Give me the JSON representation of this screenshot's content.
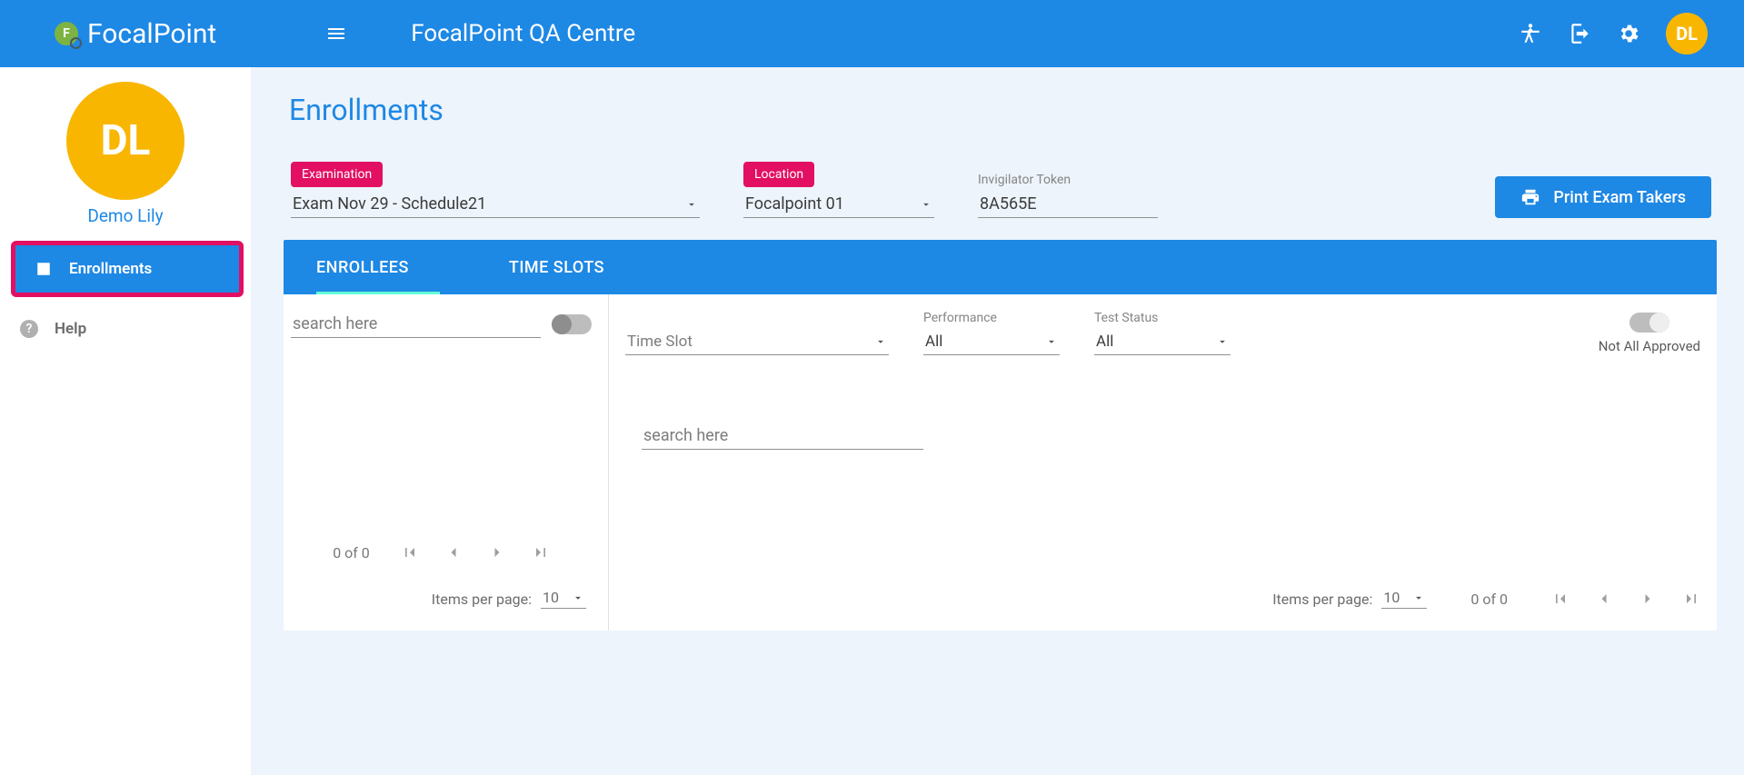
{
  "app": {
    "logo_letter": "F",
    "name": "FocalPoint",
    "centre": "FocalPoint QA Centre"
  },
  "user": {
    "initials": "DL",
    "name": "Demo Lily"
  },
  "nav": {
    "enrollments": "Enrollments",
    "help": "Help"
  },
  "page": {
    "title": "Enrollments"
  },
  "filters": {
    "exam_label": "Examination",
    "exam_value": "Exam Nov 29 - Schedule21",
    "loc_label": "Location",
    "loc_value": "Focalpoint 01",
    "token_label": "Invigilator Token",
    "token_value": "8A565E",
    "print_btn": "Print Exam Takers"
  },
  "tabs": {
    "enrollees": "ENROLLEES",
    "timeslots": "TIME SLOTS"
  },
  "left": {
    "search_ph": "search here",
    "pager": {
      "count": "0 of 0"
    },
    "ipp": {
      "label": "Items per page:",
      "value": "10"
    }
  },
  "right": {
    "timeslot_ph": "Time Slot",
    "perf": {
      "label": "Performance",
      "value": "All"
    },
    "status": {
      "label": "Test Status",
      "value": "All"
    },
    "approve": "Not All Approved",
    "search_ph": "search here",
    "ipp": {
      "label": "Items per page:",
      "value": "10"
    },
    "pager": {
      "count": "0 of 0"
    }
  }
}
